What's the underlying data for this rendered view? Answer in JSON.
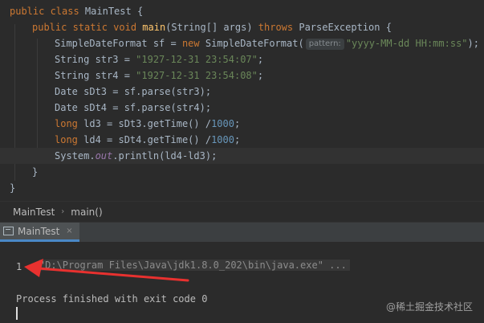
{
  "editor": {
    "lines": [
      [
        [
          "kw",
          "public class "
        ],
        [
          "",
          "MainTest {"
        ]
      ],
      [
        [
          "kw",
          "public static void "
        ],
        [
          "fn",
          "main"
        ],
        [
          "",
          "(String[] args) "
        ],
        [
          "kw",
          "throws "
        ],
        [
          "",
          "ParseException {"
        ]
      ],
      [
        [
          "",
          "SimpleDateFormat sf = "
        ],
        [
          "kw",
          "new "
        ],
        [
          "",
          "SimpleDateFormat("
        ],
        [
          "hint",
          "pattern:"
        ],
        [
          "str",
          "\"yyyy-MM-dd HH:mm:ss\""
        ],
        [
          "",
          ");"
        ]
      ],
      [
        [
          "",
          "String str3 = "
        ],
        [
          "str",
          "\"1927-12-31 23:54:07\""
        ],
        [
          "",
          ";"
        ]
      ],
      [
        [
          "",
          "String str4 = "
        ],
        [
          "str",
          "\"1927-12-31 23:54:08\""
        ],
        [
          "",
          ";"
        ]
      ],
      [
        [
          "",
          "Date sDt3 = sf.parse(str3);"
        ]
      ],
      [
        [
          "",
          "Date sDt4 = sf.parse(str4);"
        ]
      ],
      [
        [
          "kw",
          "long "
        ],
        [
          "",
          "ld3 = sDt3.getTime() /"
        ],
        [
          "num",
          "1000"
        ],
        [
          "",
          ";"
        ]
      ],
      [
        [
          "kw",
          "long "
        ],
        [
          "",
          "ld4 = sDt4.getTime() /"
        ],
        [
          "num",
          "1000"
        ],
        [
          "",
          ";"
        ]
      ],
      [
        [
          "",
          "System."
        ],
        [
          "fld",
          "out"
        ],
        [
          "",
          ".println(ld4-ld3);"
        ]
      ],
      [
        [
          "",
          "}"
        ]
      ],
      [
        [
          "",
          "}"
        ]
      ]
    ]
  },
  "breadcrumb": {
    "class_name": "MainTest",
    "method_name": "main()"
  },
  "run_tab": {
    "label": "MainTest",
    "close": "×"
  },
  "console": {
    "command": "\"D:\\Program Files\\Java\\jdk1.8.0_202\\bin\\java.exe\" ...",
    "output": "1",
    "exit_message": "Process finished with exit code 0"
  },
  "watermark": "@稀土掘金技术社区",
  "colors": {
    "arrow": "#e8312f",
    "tab_underline": "#4a88c7",
    "keyword": "#cc7832",
    "string": "#6a8759",
    "number": "#6897bb"
  }
}
